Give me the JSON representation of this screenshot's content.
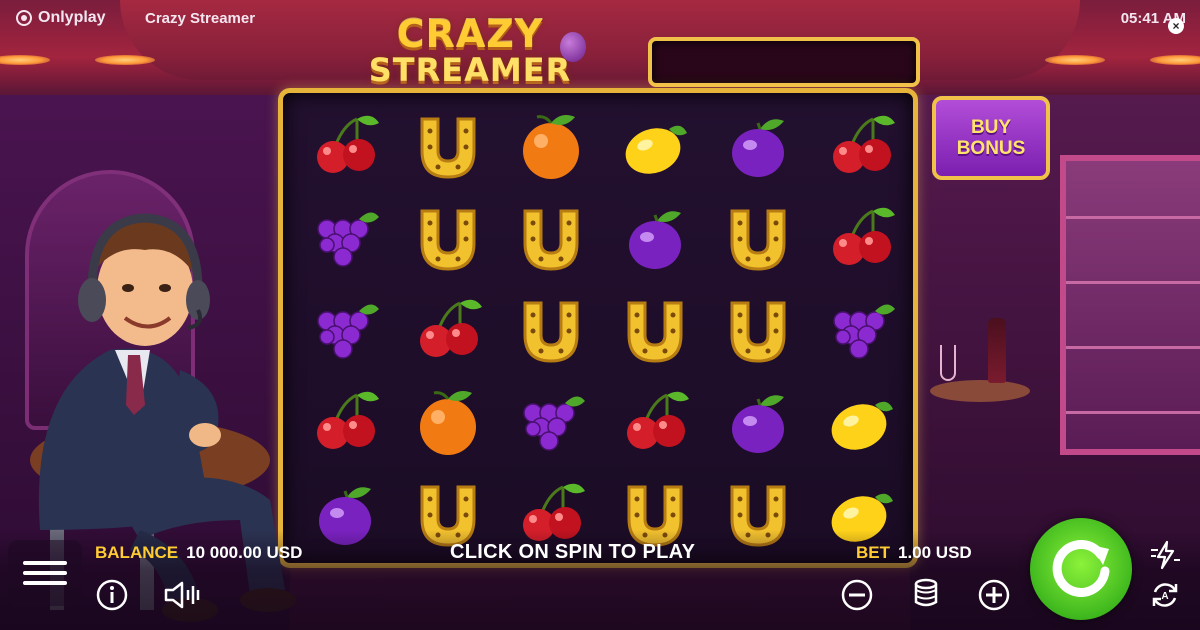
{
  "topbar": {
    "brand": "Onlyplay",
    "game_title": "Crazy Streamer",
    "time": "05:41 AM"
  },
  "logo": {
    "line1": "CRAZY",
    "line2": "STREAMER"
  },
  "buy_bonus": {
    "line1": "BUY",
    "line2": "BONUS"
  },
  "reels": [
    [
      "cherry",
      "horseshoe",
      "orange",
      "lemon",
      "plum",
      "cherry"
    ],
    [
      "grape",
      "horseshoe",
      "horseshoe",
      "plum",
      "horseshoe",
      "cherry"
    ],
    [
      "grape",
      "cherry",
      "horseshoe",
      "horseshoe",
      "horseshoe",
      "grape"
    ],
    [
      "cherry",
      "orange",
      "grape",
      "cherry",
      "plum",
      "lemon"
    ],
    [
      "plum",
      "horseshoe",
      "cherry",
      "horseshoe",
      "horseshoe",
      "lemon"
    ]
  ],
  "hud": {
    "balance_label": "BALANCE",
    "balance_value": "10 000.00 USD",
    "message": "CLICK ON SPIN TO PLAY",
    "bet_label": "BET",
    "bet_value": "1.00 USD"
  },
  "icons": {
    "menu": "hamburger-menu-icon",
    "info": "info-icon",
    "sound": "speaker-icon",
    "minus": "minus-icon",
    "coins": "coin-stack-icon",
    "plus": "plus-icon",
    "spin": "spin-arrow-icon",
    "turbo": "turbo-lightning-icon",
    "autoplay": "autoplay-icon",
    "close": "close-icon"
  },
  "colors": {
    "accent_gold": "#ffcc33",
    "spin_green": "#3fb81e",
    "frame_gold": "#e6b43a",
    "bonus_purple": "#8b2ec0"
  }
}
